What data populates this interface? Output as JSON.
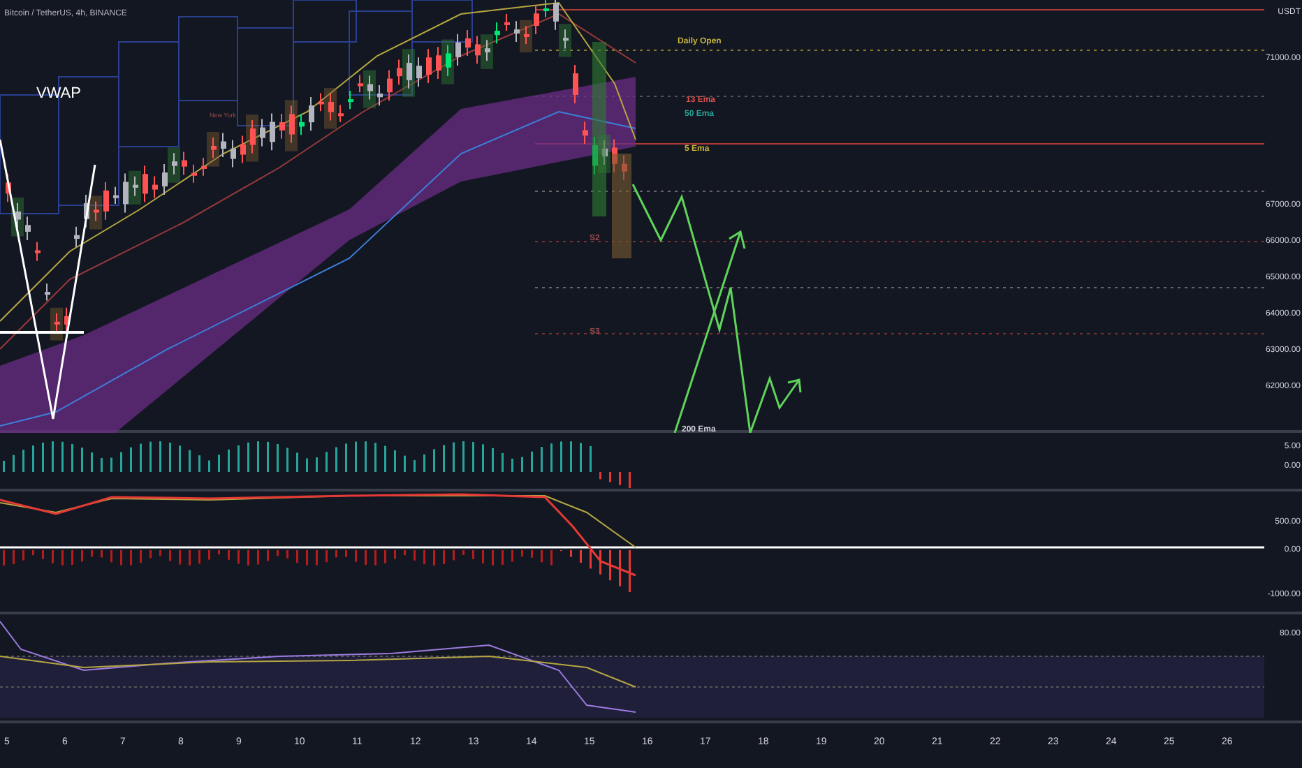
{
  "title": "Bitcoin / TetherUS, 4h, BINANCE",
  "indicator_label": "VWAP",
  "session_label": "New York",
  "annotations": [
    {
      "text": "Daily Open",
      "color": "#c9b63a"
    },
    {
      "text": "13 Ema",
      "color": "#e05050"
    },
    {
      "text": "50 Ema",
      "color": "#26a69a"
    },
    {
      "text": "5 Ema",
      "color": "#c9b63a"
    },
    {
      "text": "S2",
      "color": "#9a4a4a"
    },
    {
      "text": "S3",
      "color": "#9a4a4a"
    },
    {
      "text": "200 Ema",
      "color": "#d1d4dc"
    }
  ],
  "price_axis": {
    "currency": "USDT",
    "ticks": [
      "71000.00",
      "67000.00",
      "66000.00",
      "65000.00",
      "64000.00",
      "63000.00",
      "62000.00"
    ]
  },
  "oscillator_axis": {
    "ticks": [
      "5.00",
      "0.00"
    ]
  },
  "macd_axis": {
    "ticks": [
      "500.00",
      "0.00",
      "-1000.00"
    ]
  },
  "rsi_axis": {
    "ticks": [
      "80.00"
    ]
  },
  "time_axis": [
    "5",
    "6",
    "7",
    "8",
    "9",
    "10",
    "11",
    "12",
    "13",
    "14",
    "15",
    "16",
    "17",
    "18",
    "19",
    "20",
    "21",
    "22",
    "23",
    "24",
    "25",
    "26"
  ]
}
